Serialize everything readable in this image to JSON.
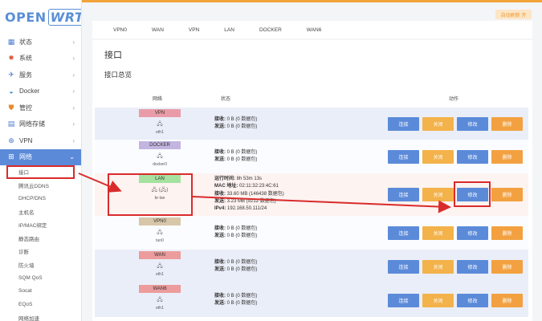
{
  "logo": {
    "open": "OPEN",
    "wrt": "WRT"
  },
  "sidebar": {
    "items": [
      {
        "label": "状态",
        "icon": "grid-icon"
      },
      {
        "label": "系统",
        "icon": "gear-icon"
      },
      {
        "label": "服务",
        "icon": "rocket-icon"
      },
      {
        "label": "Docker",
        "icon": "docker-icon"
      },
      {
        "label": "管控",
        "icon": "shield-icon"
      },
      {
        "label": "网络存储",
        "icon": "storage-icon"
      },
      {
        "label": "VPN",
        "icon": "vpn-icon"
      },
      {
        "label": "网络",
        "icon": "network-icon"
      }
    ],
    "subitems": [
      "接口",
      "腾讯云DDNS",
      "DHCP/DNS",
      "主机名",
      "IP/MAC绑定",
      "静态路由",
      "诊断",
      "防火墙",
      "SQM QoS",
      "Socat",
      "EQoS",
      "网络加速"
    ]
  },
  "toolbar": {
    "autorefresh": "自动刷新 开"
  },
  "tabs": [
    "VPN0",
    "WAN",
    "VPN",
    "LAN",
    "DOCKER",
    "WAN6"
  ],
  "page": {
    "title": "接口",
    "subtitle": "接口总览"
  },
  "table": {
    "headers": {
      "network": "网络",
      "status": "状态",
      "actions": "动作"
    },
    "buttons": {
      "connect": "连接",
      "close": "关闭",
      "edit": "修改",
      "delete": "删除"
    },
    "rows": [
      {
        "name": "VPN",
        "color": "#e99ca8",
        "icon": "🖧",
        "device": "eth1",
        "lines": [
          [
            "接收:",
            "0 B (0 数据包)"
          ],
          [
            "发送:",
            "0 B (0 数据包)"
          ]
        ]
      },
      {
        "name": "DOCKER",
        "color": "#c3b5e0",
        "icon": "🖧",
        "device": "docker0",
        "lines": [
          [
            "接收:",
            "0 B (0 数据包)"
          ],
          [
            "发送:",
            "0 B (0 数据包)"
          ]
        ]
      },
      {
        "name": "LAN",
        "color": "#a5e2a0",
        "icon": "🖧 (🖧)",
        "device": "br-lan",
        "lines": [
          [
            "运行时间:",
            "8h 53m 13s"
          ],
          [
            "MAC 地址:",
            "02:11:32:23:4C:61"
          ],
          [
            "接收:",
            "33.60 MB (146438 数据包)"
          ],
          [
            "发送:",
            "3.23 MB (9212 数据包)"
          ],
          [
            "IPv4:",
            "192.168.50.111/24"
          ]
        ]
      },
      {
        "name": "VPN0",
        "color": "#d8c6a8",
        "icon": "🖧",
        "device": "tun0",
        "lines": [
          [
            "接收:",
            "0 B (0 数据包)"
          ],
          [
            "发送:",
            "0 B (0 数据包)"
          ]
        ]
      },
      {
        "name": "WAN",
        "color": "#ec9c9c",
        "icon": "🖧",
        "device": "eth1",
        "lines": [
          [
            "接收:",
            "0 B (0 数据包)"
          ],
          [
            "发送:",
            "0 B (0 数据包)"
          ]
        ]
      },
      {
        "name": "WAN6",
        "color": "#ec9c9c",
        "icon": "🖧",
        "device": "eth1",
        "lines": [
          [
            "接收:",
            "0 B (0 数据包)"
          ],
          [
            "发送:",
            "0 B (0 数据包)"
          ]
        ]
      }
    ]
  }
}
